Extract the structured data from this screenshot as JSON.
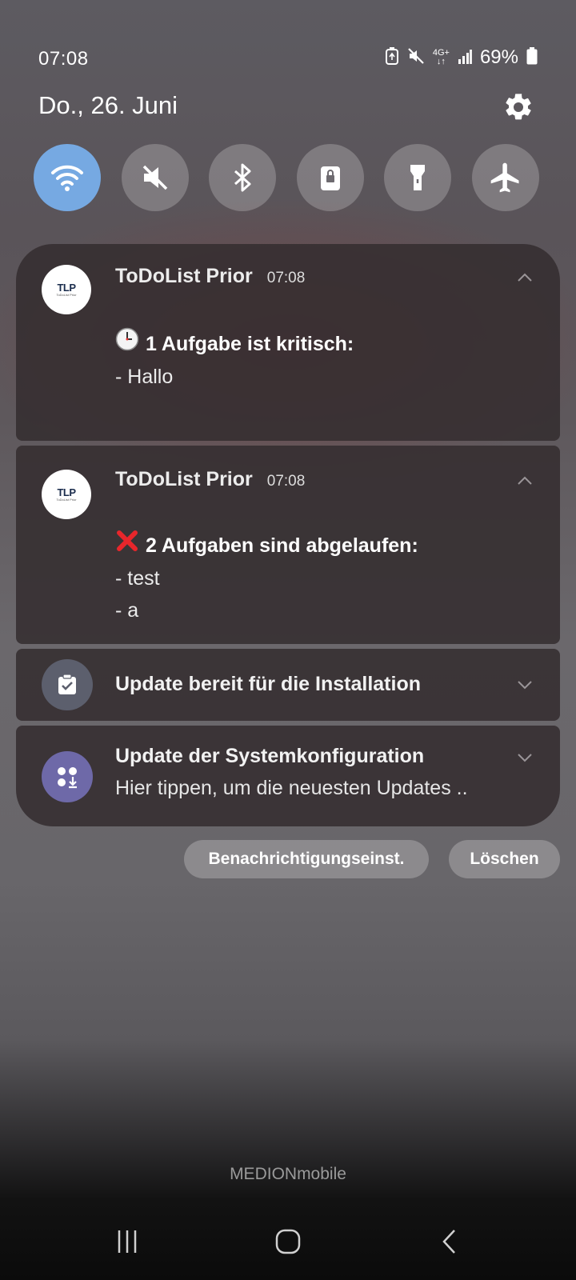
{
  "status_bar": {
    "time": "07:08",
    "battery": "69%",
    "network": "4G+",
    "icons": [
      "battery-saver-icon",
      "mute-icon",
      "network-4g-icon",
      "signal-icon",
      "battery-icon"
    ]
  },
  "header": {
    "date": "Do., 26. Juni",
    "settings_icon": "gear-icon"
  },
  "quick_toggles": [
    {
      "name": "wifi",
      "icon": "wifi-icon",
      "active": true
    },
    {
      "name": "sound",
      "icon": "mute-icon",
      "active": false
    },
    {
      "name": "bluetooth",
      "icon": "bluetooth-icon",
      "active": false
    },
    {
      "name": "rotation-lock",
      "icon": "lock-icon",
      "active": false
    },
    {
      "name": "flashlight",
      "icon": "flashlight-icon",
      "active": false
    },
    {
      "name": "airplane",
      "icon": "airplane-icon",
      "active": false
    }
  ],
  "notifications": [
    {
      "app": "ToDoList Prior",
      "time": "07:08",
      "logo_text": "TLP",
      "logo_subtext": "ToDoList Prior",
      "emoji": "🕒",
      "headline": "1 Aufgabe ist kritisch:",
      "lines": [
        "- Hallo"
      ]
    },
    {
      "app": "ToDoList Prior",
      "time": "07:08",
      "logo_text": "TLP",
      "logo_subtext": "ToDoList Prior",
      "emoji": "❌",
      "headline": "2 Aufgaben sind abgelaufen:",
      "lines": [
        "- test",
        "- a"
      ]
    },
    {
      "title": "Update bereit für die Installation",
      "icon": "checklist-icon"
    },
    {
      "title": "Update der Systemkonfiguration",
      "subtitle": "Hier tippen, um die neuesten Updates ..",
      "icon": "apps-update-icon"
    }
  ],
  "actions": {
    "settings_label": "Benachrichtigungseinst.",
    "clear_label": "Löschen"
  },
  "carrier": {
    "prefix": "MEDION",
    "suffix": "mobile"
  },
  "colors": {
    "toggle_active": "#76a9e2",
    "card_bg": "#342e30",
    "update_icon_bg": "#5c5f6d",
    "config_icon_bg": "#6e69a8",
    "clock_emoji_accent": "#ff3b30"
  }
}
